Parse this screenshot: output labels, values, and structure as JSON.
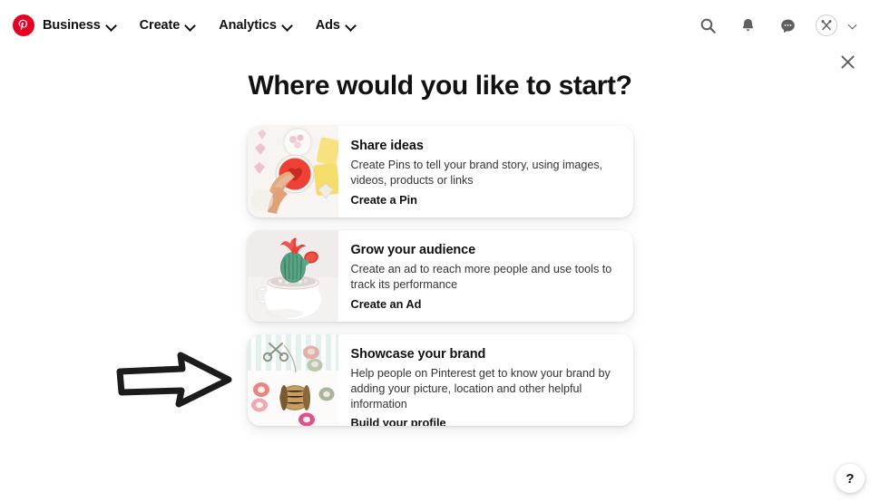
{
  "nav": {
    "logo_icon": "pinterest-logo-icon",
    "items": [
      {
        "label": "Business",
        "icon": "chevron-down-icon"
      },
      {
        "label": "Create",
        "icon": "chevron-down-icon"
      },
      {
        "label": "Analytics",
        "icon": "chevron-down-icon"
      },
      {
        "label": "Ads",
        "icon": "chevron-down-icon"
      }
    ],
    "actions": [
      {
        "name": "search-icon"
      },
      {
        "name": "notifications-bell-icon"
      },
      {
        "name": "messages-chat-icon"
      }
    ],
    "avatar": {
      "icon": "crossed-utensils-icon"
    },
    "account_chevron": "chevron-down-icon"
  },
  "close_button": {
    "label": "×",
    "icon": "close-icon"
  },
  "main": {
    "title": "Where would you like to start?",
    "cards": [
      {
        "title": "Share ideas",
        "description": "Create Pins to tell your brand story, using images, videos, products or links",
        "cta": "Create a Pin",
        "thumb_name": "baking-hearts-thumbnail"
      },
      {
        "title": "Grow your audience",
        "description": "Create an ad to reach more people and use tools to track its performance",
        "cta": "Create an Ad",
        "thumb_name": "cactus-mug-thumbnail"
      },
      {
        "title": "Showcase your brand",
        "description": "Help people on Pinterest get to know your brand by adding your picture, location and other helpful information",
        "cta": "Build your profile",
        "thumb_name": "craft-supplies-thumbnail"
      }
    ]
  },
  "annotation": {
    "name": "pointing-arrow-annotation"
  },
  "help_button": {
    "label": "?"
  },
  "colors": {
    "brand_red": "#e60023",
    "page_background": "#ffffff",
    "text_primary": "#111111",
    "text_secondary": "#333333",
    "icon_gray": "#5f5f5f"
  }
}
